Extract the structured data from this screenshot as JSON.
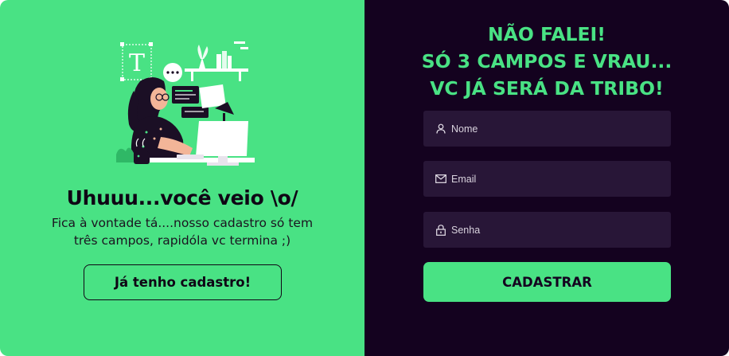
{
  "left_panel": {
    "heading": "Uhuuu...você veio \\o/",
    "subtext_line1": "Fica à vontade tá....nosso cadastro só tem",
    "subtext_line2": "três campos, rapidóla vc termina ;)",
    "login_button_label": "Já tenho cadastro!",
    "illustration_icon": "woman-at-computer-illustration"
  },
  "right_panel": {
    "heading_line1": "NÃO FALEI!",
    "heading_line2": "SÓ 3 CAMPOS E VRAU...",
    "heading_line3": "VC JÁ SERÁ DA TRIBO!",
    "fields": [
      {
        "placeholder": "Nome",
        "value": "",
        "icon": "user-icon"
      },
      {
        "placeholder": "Email",
        "value": "",
        "icon": "mail-icon"
      },
      {
        "placeholder": "Senha",
        "value": "",
        "icon": "lock-icon"
      }
    ],
    "submit_button_label": "CADASTRAR"
  },
  "colors": {
    "accent_green": "#49e284",
    "dark_background": "#14021f",
    "field_background": "#281637"
  }
}
